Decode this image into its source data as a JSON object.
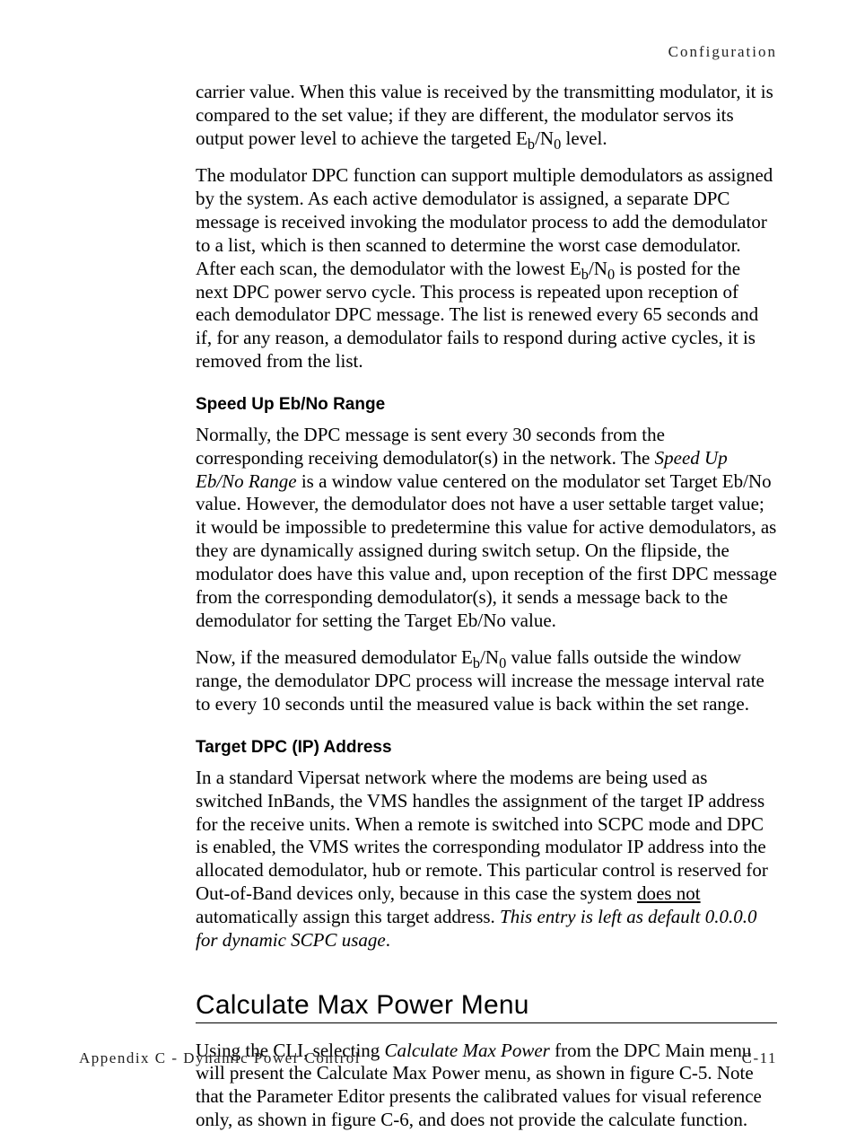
{
  "running_head": "Configuration",
  "para1_a": "carrier value. When this value is received by the transmitting modulator, it is compared to the set value; if they are different, the modulator servos its output power level to achieve the targeted E",
  "para1_sub1": "b",
  "para1_b": "/N",
  "para1_sub2": "0",
  "para1_c": " level.",
  "para2_a": "The modulator DPC function can support multiple demodulators as assigned by the system. As each active demodulator is assigned, a separate DPC message is received invoking the modulator process to add the demodulator to a list, which is then scanned to determine the worst case demodulator. After each scan, the demodulator with the lowest E",
  "para2_sub1": "b",
  "para2_b": "/N",
  "para2_sub2": "0",
  "para2_c": " is posted for the next DPC power servo cycle. This process is repeated upon reception of each demodulator DPC message. The list is renewed every 65 seconds and if, for any reason, a demodulator fails to respond during active cycles, it is removed from the list.",
  "h3_speed": "Speed Up Eb/No Range",
  "para3_a": "Normally, the DPC message is sent every 30 seconds from the corresponding receiving demodulator(s) in the network. The ",
  "para3_i": "Speed Up Eb/No Range",
  "para3_b": " is a window value centered on the modulator set Target Eb/No value. However, the demodulator does not have a user settable target value; it would be impossible to predetermine this value for active demodulators, as they are dynamically assigned during switch setup. On the flipside, the modulator does have this value and, upon reception of the first DPC message from the corresponding demodulator(s), it sends a message back to the demodulator for setting the Target Eb/No value.",
  "para4_a": "Now, if the measured demodulator E",
  "para4_sub1": "b",
  "para4_b": "/N",
  "para4_sub2": "0",
  "para4_c": " value falls outside the window range, the demodulator DPC process will increase the message interval rate to every 10 seconds until the measured value is back within the set range.",
  "h3_target": "Target DPC (IP) Address",
  "para5_a": "In a standard Vipersat network where the modems are being used as switched InBands, the VMS handles the assignment of the target IP address for the receive units. When a remote is switched into SCPC mode and DPC is enabled, the VMS writes the corresponding modulator IP address into the allocated demodulator, hub or remote. This particular control is reserved for Out-of-Band devices only, because in this case the system ",
  "para5_u": "does not",
  "para5_b": " automatically assign this target address. ",
  "para5_i": "This entry is left as default 0.0.0.0 for dynamic SCPC usage",
  "para5_c": ".",
  "h2_calc": "Calculate Max Power Menu",
  "para6_a": "Using the CLI, selecting ",
  "para6_i": "Calculate Max Power",
  "para6_b": " from the DPC Main menu will present the Calculate Max Power menu, as shown in figure C-5. Note that the Parameter Editor presents the calibrated values for visual reference only, as shown in figure C-6, and does not provide the calculate function.",
  "footer_left": "Appendix C - Dynamic Power Control",
  "footer_right": "C-11"
}
